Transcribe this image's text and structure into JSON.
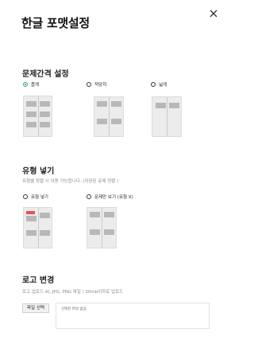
{
  "header": {
    "title": "한글 포맷설정"
  },
  "spacing_section": {
    "title": "문제간격 설정",
    "options": [
      {
        "label": "좁게",
        "selected": true
      },
      {
        "label": "적당히",
        "selected": false
      },
      {
        "label": "넓게",
        "selected": false
      }
    ]
  },
  "type_section": {
    "title": "유형 넣기",
    "description": "유형별 정렬 시 이용 가능합니다. (저장된 문제 정렬 )",
    "options": [
      {
        "label": "유형 넣기",
        "selected": false
      },
      {
        "label": "문제만 보기 (유형 X)",
        "selected": false
      }
    ],
    "badge_color": "#e05555"
  },
  "logo_section": {
    "title": "로고 변경",
    "description": "로고 업로드 AI, JPG, PNG 파일 / 30mb이하로 업로드",
    "file_button_label": "파일 선택",
    "file_status": "선택된 파일 없음"
  },
  "colors": {
    "accent": "#2f9e8a"
  }
}
